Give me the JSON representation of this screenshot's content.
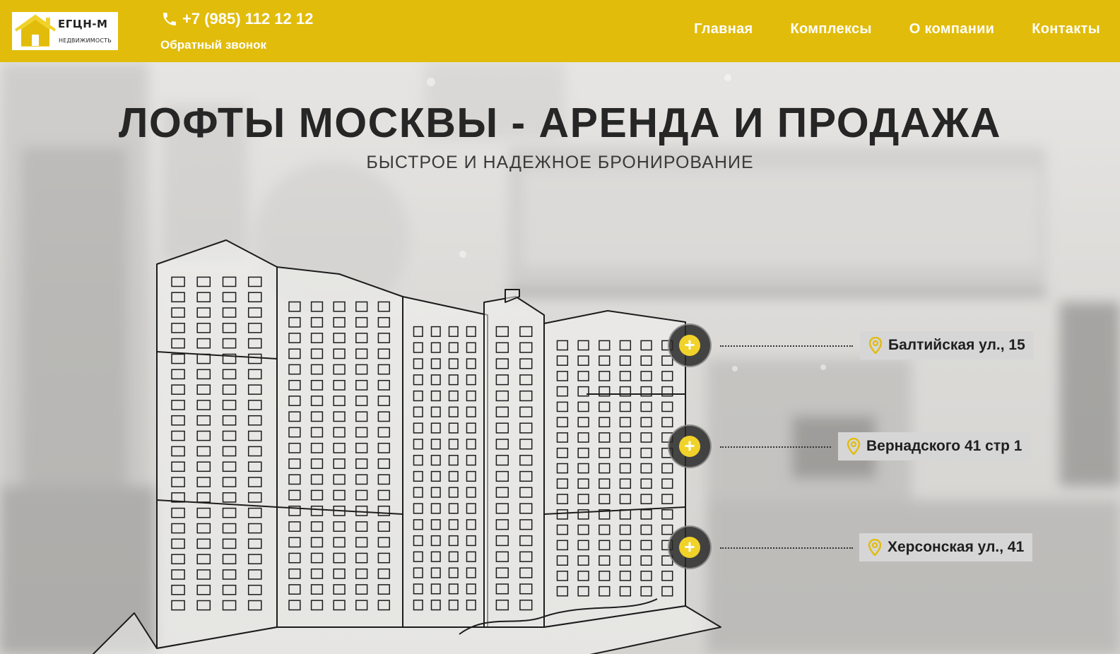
{
  "header": {
    "logo": {
      "name": "ЕГЦН-М",
      "subtitle": "НЕДВИЖИМОСТЬ"
    },
    "phone": "+7 (985) 112 12 12",
    "callback_label": "Обратный звонок",
    "nav": [
      {
        "label": "Главная"
      },
      {
        "label": "Комплексы"
      },
      {
        "label": "О компании"
      },
      {
        "label": "Контакты"
      }
    ],
    "color": "#e2bc0a"
  },
  "hero": {
    "title": "ЛОФТЫ МОСКВЫ - АРЕНДА И ПРОДАЖА",
    "subtitle": "БЫСТРОЕ И НАДЕЖНОЕ БРОНИРОВАНИЕ"
  },
  "locations": [
    {
      "label": "Балтийская ул., 15",
      "marker": "+"
    },
    {
      "label": "Вернадского 41 стр 1",
      "marker": "+"
    },
    {
      "label": "Херсонская ул., 41",
      "marker": "+"
    }
  ],
  "icons": {
    "phone": "phone-icon",
    "pin": "map-pin-icon",
    "logo": "house-icon"
  },
  "accent_color": "#f1d22a"
}
